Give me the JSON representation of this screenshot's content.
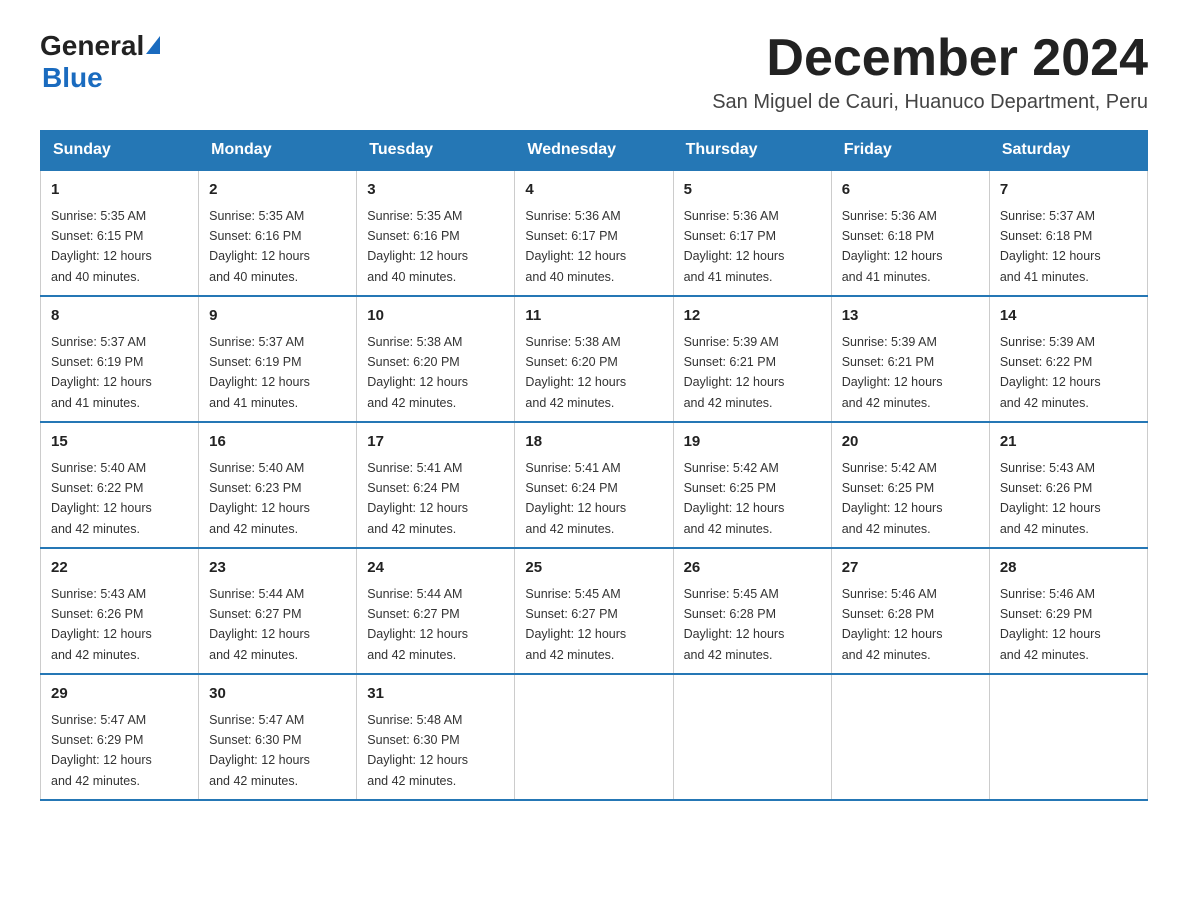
{
  "logo": {
    "text_general": "General",
    "text_blue": "Blue"
  },
  "header": {
    "month_year": "December 2024",
    "location": "San Miguel de Cauri, Huanuco Department, Peru"
  },
  "days_of_week": [
    "Sunday",
    "Monday",
    "Tuesday",
    "Wednesday",
    "Thursday",
    "Friday",
    "Saturday"
  ],
  "weeks": [
    [
      {
        "day": "1",
        "sunrise": "5:35 AM",
        "sunset": "6:15 PM",
        "daylight": "12 hours and 40 minutes."
      },
      {
        "day": "2",
        "sunrise": "5:35 AM",
        "sunset": "6:16 PM",
        "daylight": "12 hours and 40 minutes."
      },
      {
        "day": "3",
        "sunrise": "5:35 AM",
        "sunset": "6:16 PM",
        "daylight": "12 hours and 40 minutes."
      },
      {
        "day": "4",
        "sunrise": "5:36 AM",
        "sunset": "6:17 PM",
        "daylight": "12 hours and 40 minutes."
      },
      {
        "day": "5",
        "sunrise": "5:36 AM",
        "sunset": "6:17 PM",
        "daylight": "12 hours and 41 minutes."
      },
      {
        "day": "6",
        "sunrise": "5:36 AM",
        "sunset": "6:18 PM",
        "daylight": "12 hours and 41 minutes."
      },
      {
        "day": "7",
        "sunrise": "5:37 AM",
        "sunset": "6:18 PM",
        "daylight": "12 hours and 41 minutes."
      }
    ],
    [
      {
        "day": "8",
        "sunrise": "5:37 AM",
        "sunset": "6:19 PM",
        "daylight": "12 hours and 41 minutes."
      },
      {
        "day": "9",
        "sunrise": "5:37 AM",
        "sunset": "6:19 PM",
        "daylight": "12 hours and 41 minutes."
      },
      {
        "day": "10",
        "sunrise": "5:38 AM",
        "sunset": "6:20 PM",
        "daylight": "12 hours and 42 minutes."
      },
      {
        "day": "11",
        "sunrise": "5:38 AM",
        "sunset": "6:20 PM",
        "daylight": "12 hours and 42 minutes."
      },
      {
        "day": "12",
        "sunrise": "5:39 AM",
        "sunset": "6:21 PM",
        "daylight": "12 hours and 42 minutes."
      },
      {
        "day": "13",
        "sunrise": "5:39 AM",
        "sunset": "6:21 PM",
        "daylight": "12 hours and 42 minutes."
      },
      {
        "day": "14",
        "sunrise": "5:39 AM",
        "sunset": "6:22 PM",
        "daylight": "12 hours and 42 minutes."
      }
    ],
    [
      {
        "day": "15",
        "sunrise": "5:40 AM",
        "sunset": "6:22 PM",
        "daylight": "12 hours and 42 minutes."
      },
      {
        "day": "16",
        "sunrise": "5:40 AM",
        "sunset": "6:23 PM",
        "daylight": "12 hours and 42 minutes."
      },
      {
        "day": "17",
        "sunrise": "5:41 AM",
        "sunset": "6:24 PM",
        "daylight": "12 hours and 42 minutes."
      },
      {
        "day": "18",
        "sunrise": "5:41 AM",
        "sunset": "6:24 PM",
        "daylight": "12 hours and 42 minutes."
      },
      {
        "day": "19",
        "sunrise": "5:42 AM",
        "sunset": "6:25 PM",
        "daylight": "12 hours and 42 minutes."
      },
      {
        "day": "20",
        "sunrise": "5:42 AM",
        "sunset": "6:25 PM",
        "daylight": "12 hours and 42 minutes."
      },
      {
        "day": "21",
        "sunrise": "5:43 AM",
        "sunset": "6:26 PM",
        "daylight": "12 hours and 42 minutes."
      }
    ],
    [
      {
        "day": "22",
        "sunrise": "5:43 AM",
        "sunset": "6:26 PM",
        "daylight": "12 hours and 42 minutes."
      },
      {
        "day": "23",
        "sunrise": "5:44 AM",
        "sunset": "6:27 PM",
        "daylight": "12 hours and 42 minutes."
      },
      {
        "day": "24",
        "sunrise": "5:44 AM",
        "sunset": "6:27 PM",
        "daylight": "12 hours and 42 minutes."
      },
      {
        "day": "25",
        "sunrise": "5:45 AM",
        "sunset": "6:27 PM",
        "daylight": "12 hours and 42 minutes."
      },
      {
        "day": "26",
        "sunrise": "5:45 AM",
        "sunset": "6:28 PM",
        "daylight": "12 hours and 42 minutes."
      },
      {
        "day": "27",
        "sunrise": "5:46 AM",
        "sunset": "6:28 PM",
        "daylight": "12 hours and 42 minutes."
      },
      {
        "day": "28",
        "sunrise": "5:46 AM",
        "sunset": "6:29 PM",
        "daylight": "12 hours and 42 minutes."
      }
    ],
    [
      {
        "day": "29",
        "sunrise": "5:47 AM",
        "sunset": "6:29 PM",
        "daylight": "12 hours and 42 minutes."
      },
      {
        "day": "30",
        "sunrise": "5:47 AM",
        "sunset": "6:30 PM",
        "daylight": "12 hours and 42 minutes."
      },
      {
        "day": "31",
        "sunrise": "5:48 AM",
        "sunset": "6:30 PM",
        "daylight": "12 hours and 42 minutes."
      },
      null,
      null,
      null,
      null
    ]
  ],
  "labels": {
    "sunrise": "Sunrise:",
    "sunset": "Sunset:",
    "daylight": "Daylight:"
  }
}
